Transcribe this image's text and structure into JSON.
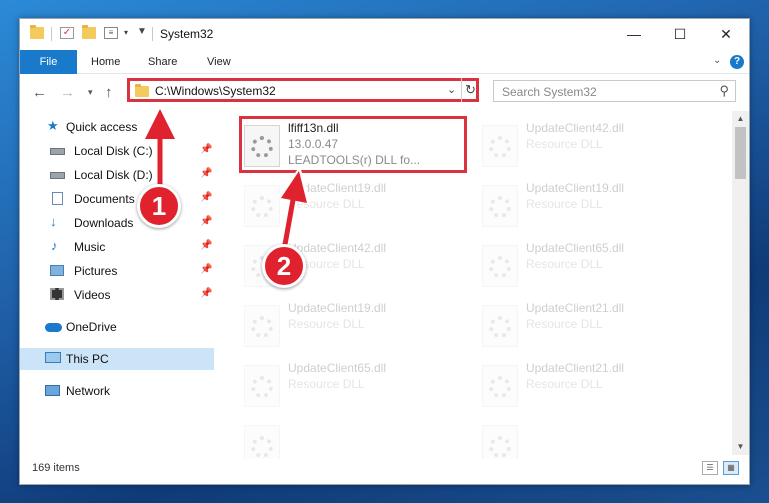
{
  "window": {
    "title": "System32",
    "tabs": [
      "File",
      "Home",
      "Share",
      "View"
    ],
    "help_label": "?",
    "minimize": "—",
    "maximize": "☐",
    "close": "✕"
  },
  "address": {
    "path": "C:\\Windows\\System32",
    "search_placeholder": "Search System32"
  },
  "nav_pane": [
    {
      "label": "Quick access",
      "icon": "star-icon",
      "pinned": false
    },
    {
      "label": "Local Disk (C:)",
      "icon": "drive-icon",
      "pinned": true
    },
    {
      "label": "Local Disk (D:)",
      "icon": "drive-icon",
      "pinned": true
    },
    {
      "label": "Documents",
      "icon": "documents-icon",
      "pinned": true
    },
    {
      "label": "Downloads",
      "icon": "downloads-icon",
      "pinned": true
    },
    {
      "label": "Music",
      "icon": "music-icon",
      "pinned": true
    },
    {
      "label": "Pictures",
      "icon": "pictures-icon",
      "pinned": true
    },
    {
      "label": "Videos",
      "icon": "videos-icon",
      "pinned": true
    },
    {
      "label": "OneDrive",
      "icon": "onedrive-icon",
      "pinned": false
    },
    {
      "label": "This PC",
      "icon": "computer-icon",
      "pinned": false,
      "selected": true
    },
    {
      "label": "Network",
      "icon": "network-icon",
      "pinned": false
    }
  ],
  "files": [
    {
      "name": "lfiff13n.dll",
      "version": "13.0.0.47",
      "description": "LEADTOOLS(r) DLL fo..."
    },
    {
      "name": "UpdateClient42.dll",
      "description": "Resource DLL"
    },
    {
      "name": "UpdateClient19.dll",
      "description": "Resource DLL"
    },
    {
      "name": "UpdateClient19.dll",
      "description": "Resource DLL"
    },
    {
      "name": "UpdateClient42.dll",
      "description": "Resource DLL"
    },
    {
      "name": "UpdateClient65.dll",
      "description": "Resource DLL"
    },
    {
      "name": "UpdateClient19.dll",
      "description": "Resource DLL"
    },
    {
      "name": "UpdateClient21.dll",
      "description": "Resource DLL"
    },
    {
      "name": "UpdateClient65.dll",
      "description": "Resource DLL"
    },
    {
      "name": "UpdateClient21.dll",
      "description": "Resource DLL"
    }
  ],
  "status": {
    "item_count": "169 items"
  },
  "annotations": {
    "step1": "1",
    "step2": "2"
  },
  "colors": {
    "accent": "#1979ca",
    "highlight": "#d9333f",
    "selected": "#cce4f7"
  }
}
